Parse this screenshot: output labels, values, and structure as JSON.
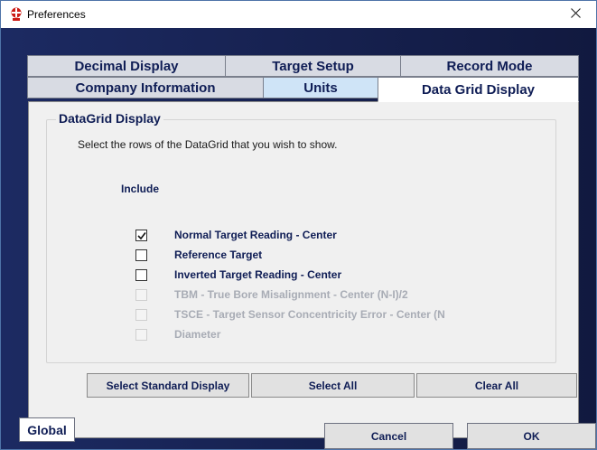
{
  "window": {
    "title": "Preferences",
    "app_icon": "cross-flag-icon",
    "close_icon": "close-icon"
  },
  "colors": {
    "client_gradient_left": "#1c2a62",
    "client_gradient_right": "#11193f",
    "label_navy": "#0f1d55",
    "tab_gray": "#d8dbe3",
    "tab_highlight": "#cfe4f7",
    "disabled_text": "#a8acb5",
    "app_icon_red": "#cc1a14"
  },
  "tabs": {
    "row1": [
      "Decimal Display",
      "Target Setup",
      "Record Mode"
    ],
    "row2": [
      "Company Information",
      "Units",
      "Data Grid Display"
    ],
    "active": "Data Grid Display"
  },
  "panel": {
    "group_title": "DataGrid Display",
    "instructions": "Select the rows of the DataGrid that you wish to show.",
    "include_header": "Include",
    "rows": [
      {
        "label": "Normal Target Reading - Center",
        "checked": true,
        "enabled": true
      },
      {
        "label": "Reference Target",
        "checked": false,
        "enabled": true
      },
      {
        "label": "Inverted Target Reading - Center",
        "checked": false,
        "enabled": true
      },
      {
        "label": "TBM - True Bore Misalignment - Center (N-I)/2",
        "checked": false,
        "enabled": false
      },
      {
        "label": "TSCE - Target Sensor Concentricity Error - Center (N",
        "checked": false,
        "enabled": false
      },
      {
        "label": "Diameter",
        "checked": false,
        "enabled": false
      }
    ],
    "buttons": {
      "standard": "Select Standard Display",
      "select_all": "Select All",
      "clear_all": "Clear All"
    }
  },
  "footer": {
    "global": "Global",
    "cancel": "Cancel",
    "ok": "OK"
  }
}
